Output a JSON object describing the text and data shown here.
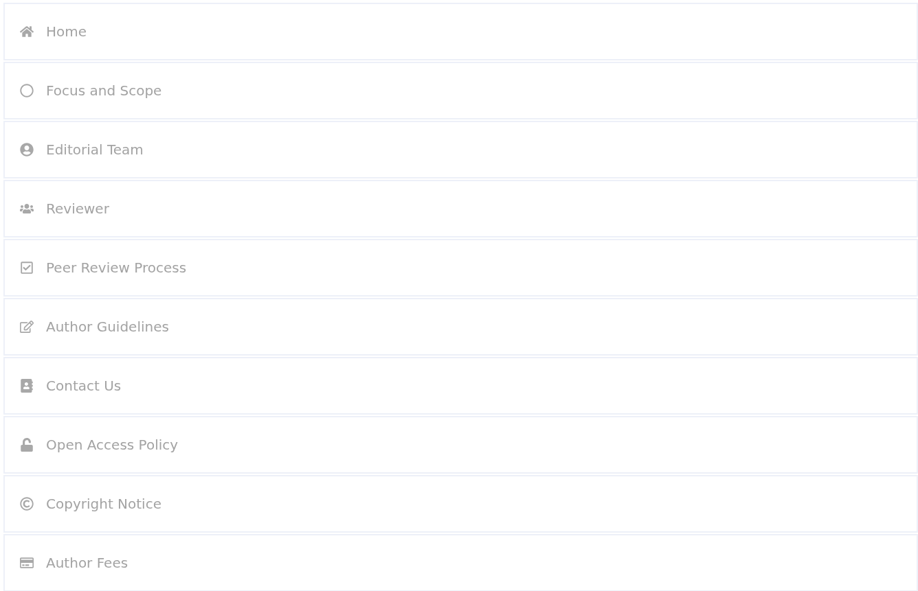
{
  "menu": [
    {
      "label": "Home"
    },
    {
      "label": "Focus and Scope"
    },
    {
      "label": "Editorial Team"
    },
    {
      "label": "Reviewer"
    },
    {
      "label": "Peer Review Process"
    },
    {
      "label": "Author Guidelines"
    },
    {
      "label": "Contact Us"
    },
    {
      "label": "Open Access Policy"
    },
    {
      "label": "Copyright Notice"
    },
    {
      "label": "Author Fees"
    }
  ]
}
